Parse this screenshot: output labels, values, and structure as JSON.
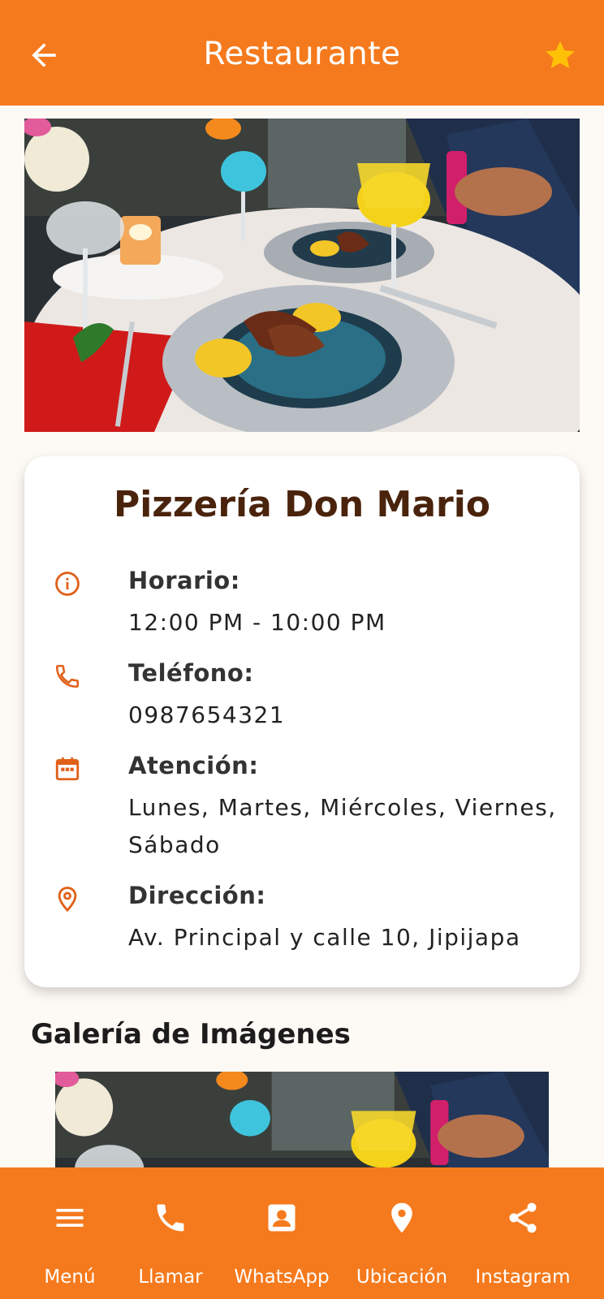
{
  "app_bar": {
    "title": "Restaurante"
  },
  "restaurant": {
    "name": "Pizzería Don Mario",
    "details": [
      {
        "icon": "info-icon",
        "label": "Horario:",
        "value": "12:00 PM - 10:00 PM"
      },
      {
        "icon": "phone-icon",
        "label": "Teléfono:",
        "value": "0987654321"
      },
      {
        "icon": "calendar-icon",
        "label": "Atención:",
        "value": "Lunes, Martes, Miércoles, Viernes, Sábado"
      },
      {
        "icon": "location-pin-icon",
        "label": "Dirección:",
        "value": "Av. Principal y calle 10, Jipijapa"
      }
    ]
  },
  "gallery": {
    "title": "Galería de Imágenes"
  },
  "bottom_nav": [
    {
      "icon": "menu-icon",
      "label": "Menú"
    },
    {
      "icon": "phone-icon",
      "label": "Llamar"
    },
    {
      "icon": "contact-card-icon",
      "label": "WhatsApp"
    },
    {
      "icon": "location-pin-icon",
      "label": "Ubicación"
    },
    {
      "icon": "share-icon",
      "label": "Instagram"
    }
  ],
  "colors": {
    "primary": "#f57a1d",
    "accent_star": "#ffc107",
    "title_brown": "#4a230c",
    "icon_orange": "#e0601a"
  }
}
